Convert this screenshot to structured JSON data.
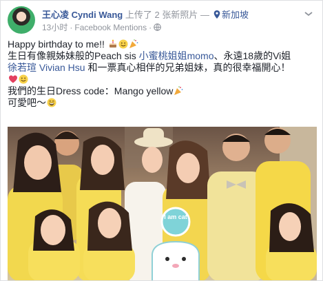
{
  "post": {
    "author": "王心凌 Cyndi Wang",
    "action": "上传了 2 张新照片",
    "separator": "—",
    "location": "新加坡",
    "time": "13小时",
    "source": "Facebook Mentions",
    "text": {
      "line1": "Happy birthday to me!!",
      "line2_prefix": "生日有像親姊妹般的Peach sis ",
      "line2_link1": "小蜜桃姐姐momo",
      "line2_mid": "、永遠18歲的Vi姐",
      "line3_link": "徐若瑄 Vivian Hsu",
      "line3_suffix": " 和一票真心相伴的兄弟姐妹，真的很幸福開心！",
      "line5": "我們的生日Dress code：Mango yellow",
      "line6": "可愛吧～"
    },
    "photo_sticker": "I am cat"
  },
  "icons": [
    "avatar",
    "pin-icon",
    "globe-icon",
    "more-icon",
    "cake-emoji",
    "smile-emoji",
    "party-emoji",
    "heart-emoji",
    "grin-emoji"
  ],
  "colors": {
    "link": "#385898",
    "meta": "#90949c",
    "text": "#1d2129",
    "dress_yellow": "#f0d94a"
  }
}
